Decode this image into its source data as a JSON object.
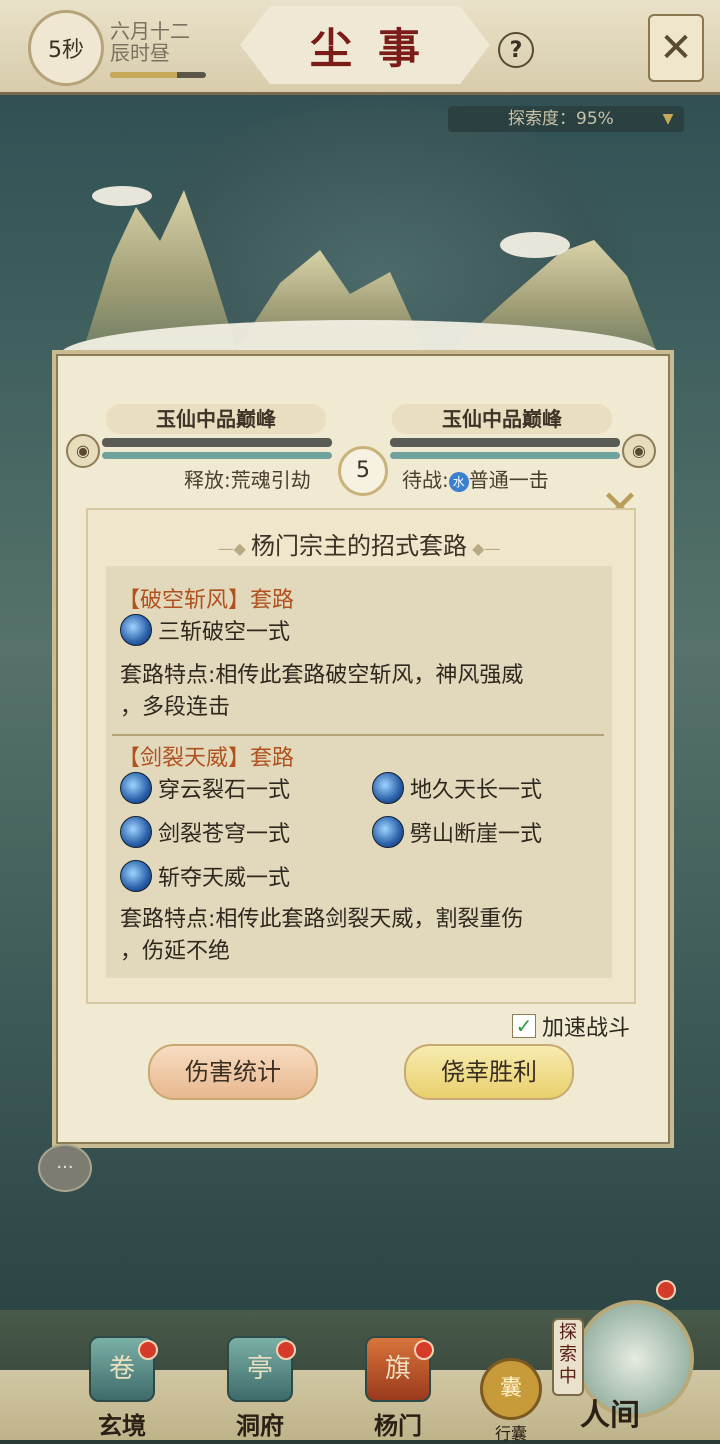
{
  "header": {
    "timer": "5秒",
    "date_line1": "六月十二",
    "date_line2": "辰时昼",
    "date_progress": 0.7,
    "title": "尘事",
    "help_label": "?",
    "close_label": "✕"
  },
  "explore_degree": "探索度：95%",
  "battle": {
    "left_name": "玉仙中品巅峰",
    "right_name": "玉仙中品巅峰",
    "round": "5",
    "left_action": "释放:荒魂引劫",
    "right_action_prefix": "待战:",
    "right_action_badge": "水",
    "right_action": "普通一击"
  },
  "card": {
    "title": "杨门宗主的招式套路",
    "sections": [
      {
        "head": "【破空斩风】套路",
        "moves": [
          "三斩破空一式"
        ],
        "desc_l1": "套路特点:相传此套路破空斩风，神风强威",
        "desc_l2": "，多段连击"
      },
      {
        "head": "【剑裂天威】套路",
        "moves": [
          "穿云裂石一式",
          "地久天长一式",
          "剑裂苍穹一式",
          "劈山断崖一式",
          "斩夺天威一式"
        ],
        "desc_l1": "套路特点:相传此套路剑裂天威，割裂重伤",
        "desc_l2": "，伤延不绝"
      }
    ]
  },
  "speed_battle": "加速战斗",
  "buttons": {
    "damage": "伤害统计",
    "win": "侥幸胜利"
  },
  "nav": {
    "items": [
      "玄境",
      "洞府",
      "杨门"
    ],
    "bag": "行囊",
    "explore_tag": "探索中",
    "world": "人间"
  }
}
